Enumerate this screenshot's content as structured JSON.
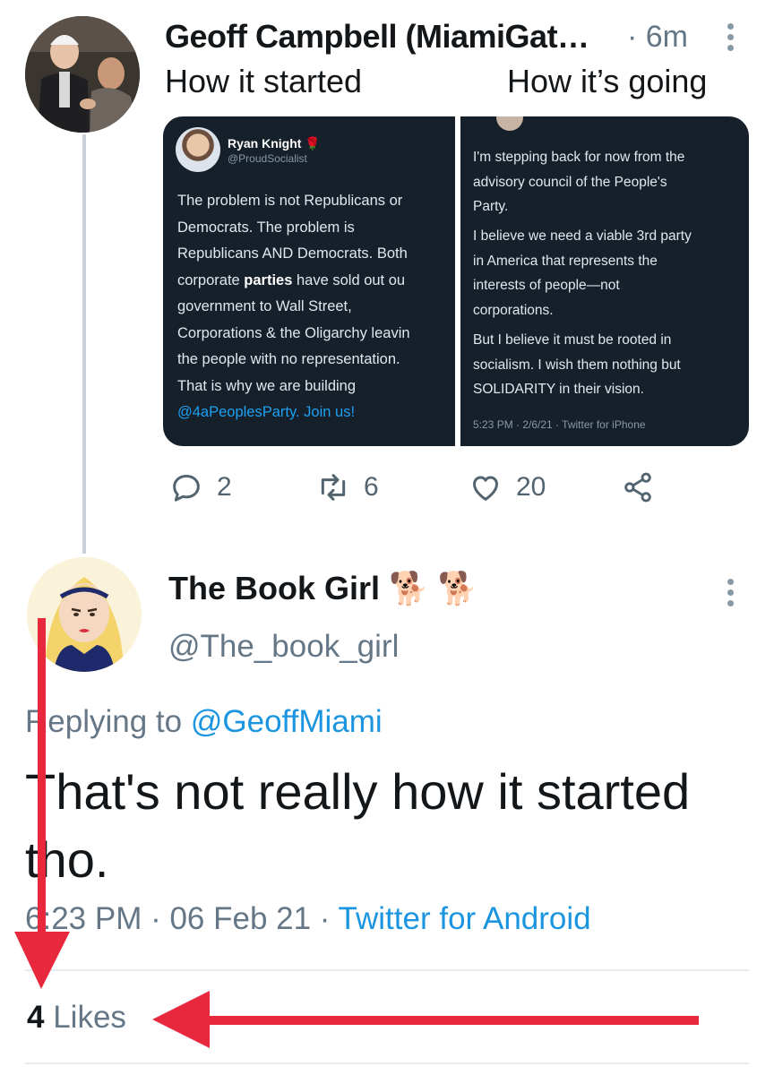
{
  "tweet1": {
    "author": "Geoff Campbell (MiamiGat…",
    "time": "· 6m",
    "text_left": "How it started",
    "text_right": "How it’s going",
    "media": {
      "left": {
        "name": "Ryan Knight",
        "handle": "@ProudSocialist",
        "lines": [
          "The problem is not Republicans or",
          "Democrats. The problem is",
          "Republicans AND Democrats. Both",
          "corporate parties have sold out ou",
          "government to Wall Street,",
          "Corporations & the Oligarchy leavin",
          "the people with no representation.",
          "That is why we are building",
          "@4aPeoplesParty. Join us!"
        ]
      },
      "right": {
        "para1": [
          "I'm stepping back for now from the",
          "advisory council of the People's",
          "Party."
        ],
        "para2": [
          "I believe we need a viable 3rd party",
          "in America that represents the",
          "interests of people—not",
          "corporations."
        ],
        "para3": [
          "But I believe it must be rooted in",
          "socialism. I wish them nothing but",
          "SOLIDARITY in their vision."
        ],
        "footer": "5:23 PM · 2/6/21 · Twitter for iPhone"
      }
    },
    "actions": {
      "replies": "2",
      "retweets": "6",
      "likes": "20"
    }
  },
  "tweet2": {
    "author": "The Book Girl",
    "author_emoji": "🐕 🐕",
    "handle": "@The_book_girl",
    "reply_prefix": "Replying to",
    "reply_to": "@GeoffMiami",
    "body": "That's not really how it started tho.",
    "timestamp": "6:23 PM · 06 Feb 21 ·",
    "source": "Twitter for Android",
    "likes_count": "4",
    "likes_label": "Likes"
  },
  "colors": {
    "accent": "#1b95e0",
    "annotation": "#e8283c",
    "dark_panel": "#15202b"
  }
}
